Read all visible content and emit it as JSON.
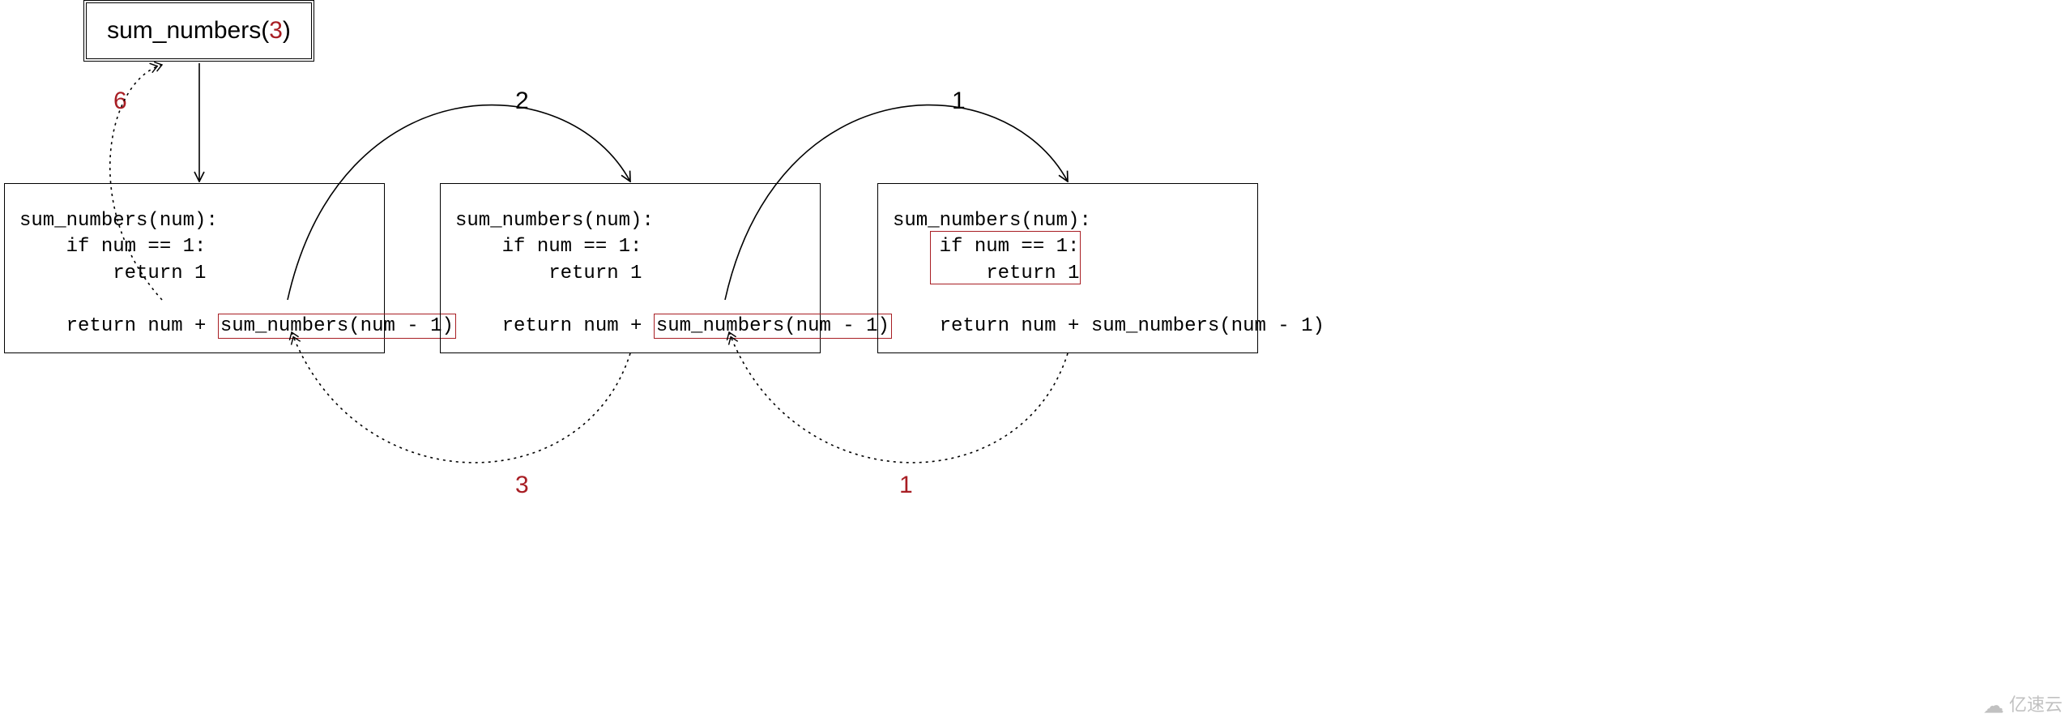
{
  "colors": {
    "red": "#a81e24",
    "black": "#000000"
  },
  "call": {
    "fn": "sum_numbers(",
    "arg": "3",
    "close": ")"
  },
  "def": {
    "line1": "sum_numbers(num):",
    "line2": "    if num == 1:",
    "line3": "        return 1",
    "line4a": "    return num + ",
    "line4b": "sum_numbers(num - 1)"
  },
  "edges": {
    "down_to_box1": {
      "kind": "call"
    },
    "fwd12": {
      "label": "2",
      "kind": "call"
    },
    "fwd23": {
      "label": "1",
      "kind": "call"
    },
    "ret32": {
      "label": "1",
      "kind": "return"
    },
    "ret21": {
      "label": "3",
      "kind": "return"
    },
    "ret10": {
      "label": "6",
      "kind": "return"
    }
  },
  "watermark": "亿速云"
}
